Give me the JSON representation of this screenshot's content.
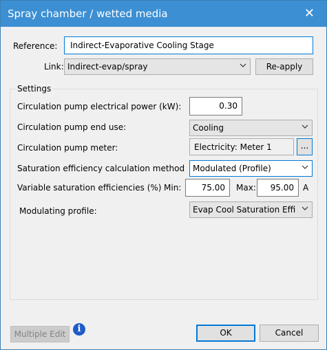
{
  "window": {
    "title": "Spray chamber / wetted media"
  },
  "reference": {
    "label": "Reference:",
    "value": "Indirect-Evaporative Cooling Stage"
  },
  "link": {
    "label": "Link:",
    "value": "Indirect-evap/spray",
    "reapply_label": "Re-apply"
  },
  "settings": {
    "title": "Settings",
    "pump_power": {
      "label": "Circulation pump electrical power (kW):",
      "value": "0.30"
    },
    "pump_end_use": {
      "label": "Circulation pump end use:",
      "value": "Cooling"
    },
    "pump_meter": {
      "label": "Circulation pump meter:",
      "value": "Electricity: Meter 1",
      "browse_label": "..."
    },
    "saturation_method": {
      "label": "Saturation efficiency calculation method",
      "value": "Modulated (Profile)"
    },
    "variable_efficiencies": {
      "label": "Variable saturation efficiencies (%)",
      "min_label": "Min:",
      "min_value": "75.00",
      "max_label": "Max:",
      "max_value": "95.00",
      "suffix": "A"
    },
    "modulating_profile": {
      "label": "Modulating profile:",
      "value": "Evap Cool Saturation Effici"
    }
  },
  "footer": {
    "multiple_edit_label": "Multiple Edit",
    "info_glyph": "i",
    "ok_label": "OK",
    "cancel_label": "Cancel"
  },
  "colors": {
    "titlebar": "#3c8fd3",
    "focus": "#0078d7",
    "dialog_bg": "#f0f0f0"
  }
}
